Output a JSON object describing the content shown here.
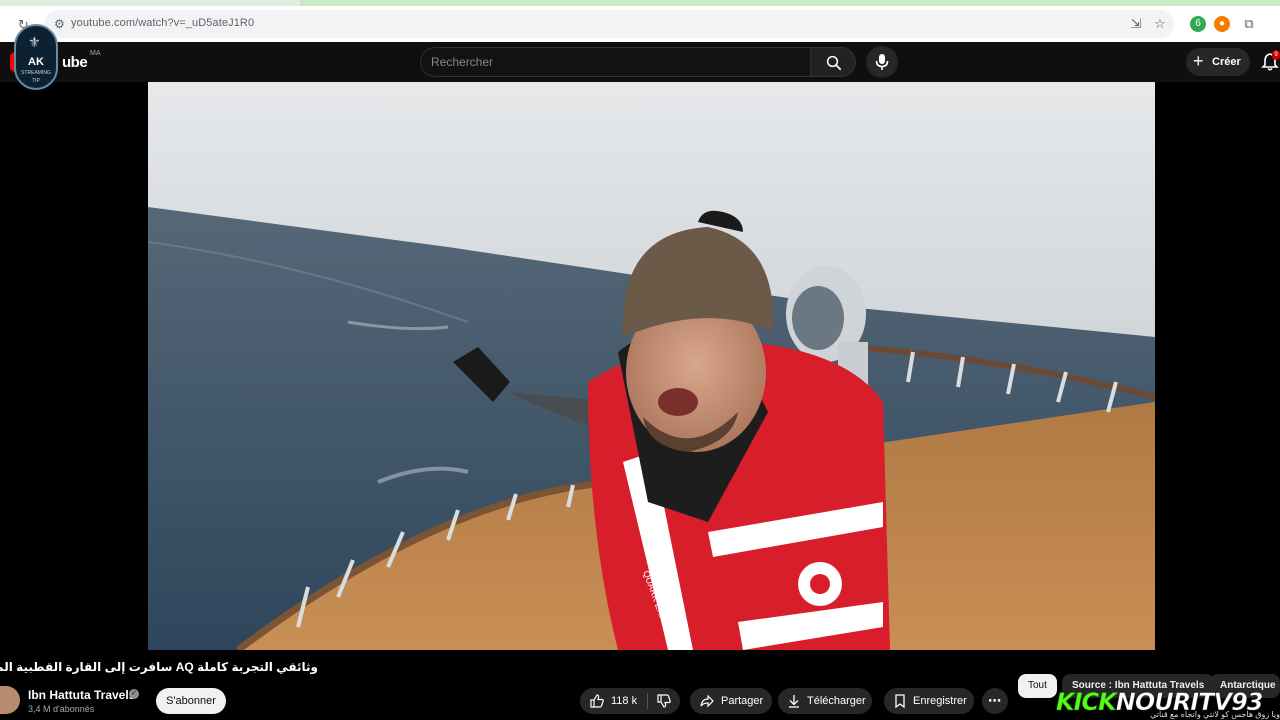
{
  "browser": {
    "url": "youtube.com/watch?v=_uD5ateJ1R0",
    "extension_badge": "6"
  },
  "header": {
    "wordmark": "ube",
    "region": "MA",
    "search_placeholder": "Rechercher",
    "create_label": "Créer",
    "notification_count": "9",
    "overlay_badge": {
      "text": "AK",
      "sub1": "STREAMING",
      "sub2": "TIP"
    }
  },
  "video": {
    "title": "وثائقي التجربة كاملة AQ سافرت إلى القارة القطبية المتجمدة أنتاركتيكا",
    "jacket_text": "QUARK EXPEDITION"
  },
  "channel": {
    "name": "Ibn Hattuta Travels",
    "subscribers": "3,4 M d'abonnés",
    "subscribe_label": "S'abonner"
  },
  "actions": {
    "likes": "118 k",
    "share_label": "Partager",
    "download_label": "Télécharger",
    "save_label": "Enregistrer"
  },
  "chips": [
    {
      "label": "Tout",
      "active": true
    },
    {
      "label": "Source : Ibn Hattuta Travels",
      "active": false
    },
    {
      "label": "Antarctique",
      "active": false
    }
  ],
  "overlay": {
    "kick_word": "KICK",
    "kick_handle": "NOURITV93",
    "ticker_text": "ويا زوق هاجس كو لانتي واتجاه مع قناتي"
  },
  "colors": {
    "youtube_red": "#ff0000",
    "kick_green": "#53fc18",
    "jacket_red": "#d81e2a"
  }
}
